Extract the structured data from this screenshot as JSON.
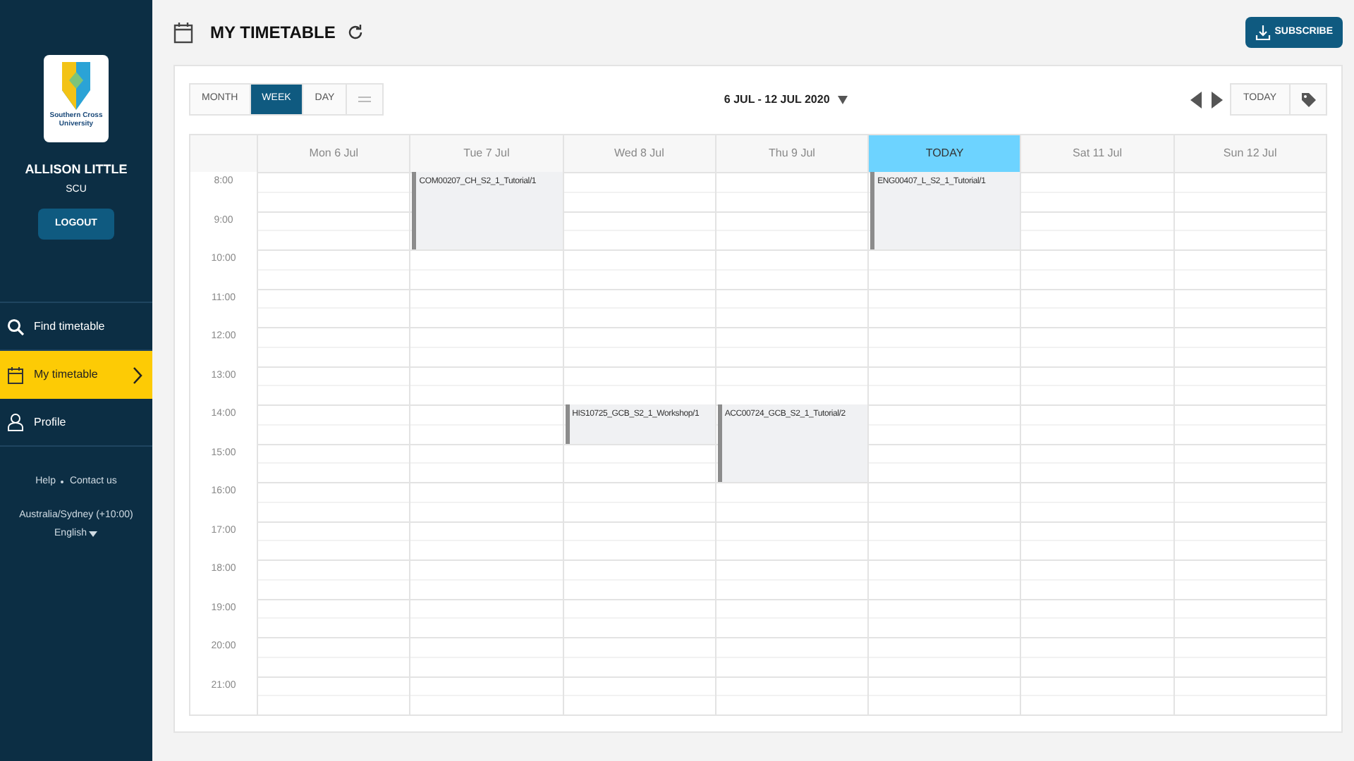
{
  "sidebar": {
    "logo_text": "Southern Cross University",
    "user_name": "ALLISON LITTLE",
    "user_org": "SCU",
    "logout": "LOGOUT",
    "nav": [
      {
        "kind": "search",
        "label": "Find timetable",
        "selected": false
      },
      {
        "kind": "calendar",
        "label": "My timetable",
        "selected": true
      },
      {
        "kind": "person",
        "label": "Profile",
        "selected": false
      }
    ],
    "links": [
      "Help",
      "Contact us"
    ],
    "timezone": "Australia/Sydney (+10:00)",
    "language": "English"
  },
  "header": {
    "title": "MY TIMETABLE",
    "subscribe": "SUBSCRIBE"
  },
  "toolbar": {
    "views": [
      {
        "label": "MONTH",
        "selected": false
      },
      {
        "label": "WEEK",
        "selected": true
      },
      {
        "label": "DAY",
        "selected": false
      },
      {
        "kind": "list",
        "selected": false
      }
    ],
    "date_range": "6 JUL - 12 JUL 2020",
    "today": "TODAY"
  },
  "calendar": {
    "days": [
      {
        "label": "Mon 6 Jul",
        "today": false
      },
      {
        "label": "Tue 7 Jul",
        "today": false
      },
      {
        "label": "Wed 8 Jul",
        "today": false
      },
      {
        "label": "Thu 9 Jul",
        "today": false
      },
      {
        "label": "TODAY",
        "today": true
      },
      {
        "label": "Sat 11 Jul",
        "today": false
      },
      {
        "label": "Sun 12 Jul",
        "today": false
      }
    ],
    "rows": [
      {
        "time": "8:00",
        "cells": [
          {
            "kind": "empty"
          },
          {
            "kind": "event",
            "title": "COM00207_CH_S2_1_Tutorial/1"
          },
          {
            "kind": "empty"
          },
          {
            "kind": "empty"
          },
          {
            "kind": "event",
            "title": "ENG00407_L_S2_1_Tutorial/1"
          },
          {
            "kind": "empty"
          },
          {
            "kind": "empty"
          }
        ]
      },
      {
        "time": "9:00",
        "cells": [
          {
            "kind": "empty"
          },
          {
            "kind": "continued"
          },
          {
            "kind": "empty"
          },
          {
            "kind": "empty"
          },
          {
            "kind": "continued"
          },
          {
            "kind": "empty"
          },
          {
            "kind": "empty"
          }
        ]
      },
      {
        "time": "10:00"
      },
      {
        "time": "11:00"
      },
      {
        "time": "12:00"
      },
      {
        "time": "13:00"
      },
      {
        "time": "14:00",
        "cells": [
          {
            "kind": "empty"
          },
          {
            "kind": "empty"
          },
          {
            "kind": "event",
            "title": "HIS10725_GCB_S2_1_Workshop/1"
          },
          {
            "kind": "event",
            "title": "ACC00724_GCB_S2_1_Tutorial/2"
          },
          {
            "kind": "empty"
          },
          {
            "kind": "empty"
          },
          {
            "kind": "empty"
          }
        ]
      },
      {
        "time": "15:00",
        "cells": [
          {
            "kind": "empty"
          },
          {
            "kind": "empty"
          },
          {
            "kind": "empty"
          },
          {
            "kind": "continued"
          },
          {
            "kind": "empty"
          },
          {
            "kind": "empty"
          },
          {
            "kind": "empty"
          }
        ]
      },
      {
        "time": "16:00"
      },
      {
        "time": "17:00"
      },
      {
        "time": "18:00"
      },
      {
        "time": "19:00"
      },
      {
        "time": "20:00"
      },
      {
        "time": "21:00"
      }
    ]
  }
}
